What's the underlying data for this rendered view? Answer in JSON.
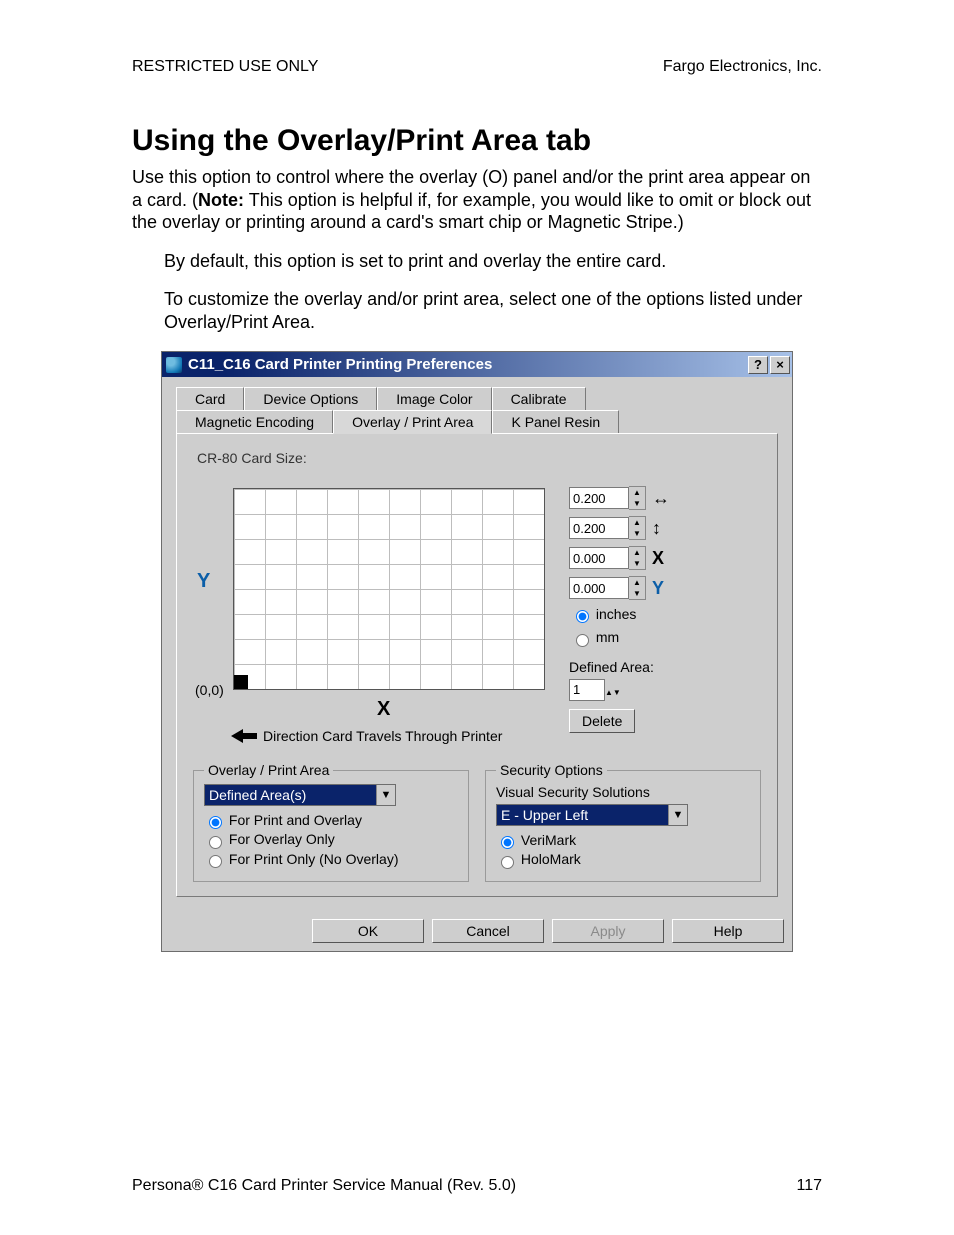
{
  "header": {
    "left": "RESTRICTED USE ONLY",
    "right": "Fargo Electronics, Inc."
  },
  "title": "Using the Overlay/Print Area tab",
  "para1": "Use this option to control where the overlay (O) panel and/or the print area appear on a card. (",
  "para1_bold": "Note:",
  "para1_tail": "  This option is helpful if, for example, you would like to omit or block out the overlay or printing around a card's smart chip or Magnetic Stripe.)",
  "bullet1": "By default, this option is set to print and overlay the entire card.",
  "bullet2": "To customize the overlay and/or print area, select one of the options listed under Overlay/Print Area.",
  "footer": {
    "left": "Persona® C16 Card Printer Service Manual (Rev. 5.0)",
    "page": "117"
  },
  "dialog": {
    "title": "C11_C16 Card Printer Printing Preferences",
    "help_glyph": "?",
    "close_glyph": "×",
    "tabs_row1": [
      "Card",
      "Device Options",
      "Image Color",
      "Calibrate"
    ],
    "tabs_row2": [
      "Magnetic Encoding",
      "Overlay / Print Area",
      "K Panel Resin"
    ],
    "active_tab": "Overlay / Print Area",
    "card_size_label": "CR-80 Card Size:",
    "axis": {
      "y": "Y",
      "x": "X",
      "origin": "(0,0)"
    },
    "direction_label": "Direction Card Travels Through Printer",
    "spins": {
      "w": {
        "value": "0.200",
        "glyph": "↔"
      },
      "h": {
        "value": "0.200",
        "glyph": "↕"
      },
      "x": {
        "value": "0.000",
        "glyph": "X"
      },
      "y": {
        "value": "0.000",
        "glyph": "Y"
      }
    },
    "units": {
      "inches": "inches",
      "mm": "mm",
      "selected": "inches"
    },
    "defined_area": {
      "label": "Defined Area:",
      "value": "1",
      "delete": "Delete"
    },
    "overlay_group": {
      "legend": "Overlay / Print Area",
      "combo": "Defined Area(s)",
      "opts": {
        "both": "For Print and Overlay",
        "overlay": "For Overlay Only",
        "print": "For Print Only (No Overlay)"
      },
      "selected": "both"
    },
    "security_group": {
      "legend": "Security Options",
      "subtitle": "Visual Security Solutions",
      "combo": "E - Upper Left",
      "opts": {
        "verimark": "VeriMark",
        "holomark": "HoloMark"
      },
      "selected": "verimark"
    },
    "buttons": {
      "ok": "OK",
      "cancel": "Cancel",
      "apply": "Apply",
      "help": "Help"
    }
  }
}
